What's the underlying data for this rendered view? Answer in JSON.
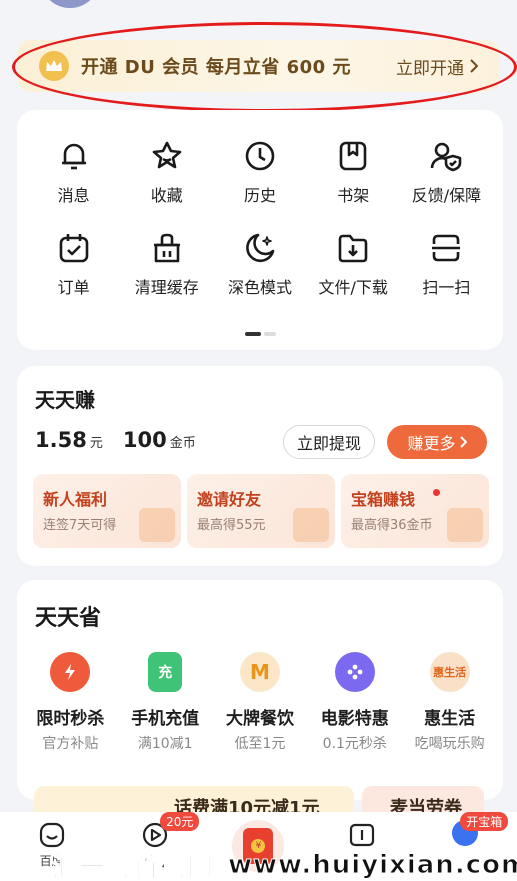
{
  "vip_banner": {
    "title": "开通 DU 会员 每月立省 600 元",
    "action": "立即开通",
    "accent": "#6b4a1c"
  },
  "tools": [
    {
      "label": "消息",
      "icon": "bell-icon"
    },
    {
      "label": "收藏",
      "icon": "star-icon"
    },
    {
      "label": "历史",
      "icon": "clock-icon"
    },
    {
      "label": "书架",
      "icon": "bookmark-icon"
    },
    {
      "label": "反馈/保障",
      "icon": "user-shield-icon"
    },
    {
      "label": "订单",
      "icon": "calendar-check-icon"
    },
    {
      "label": "清理缓存",
      "icon": "clean-cache-icon"
    },
    {
      "label": "深色模式",
      "icon": "moon-icon"
    },
    {
      "label": "文件/下载",
      "icon": "folder-download-icon"
    },
    {
      "label": "扫一扫",
      "icon": "scan-icon"
    }
  ],
  "earn": {
    "title": "天天赚",
    "cash_value": "1.58",
    "cash_unit": "元",
    "coins_value": "100",
    "coins_unit": "金币",
    "withdraw_label": "立即提现",
    "earn_more_label": "赚更多",
    "tasks": [
      {
        "title": "新人福利",
        "subtitle": "连签7天可得"
      },
      {
        "title": "邀请好友",
        "subtitle": "最高得55元"
      },
      {
        "title": "宝箱赚钱",
        "subtitle": "最高得36金币"
      }
    ],
    "accent": "#ee6a3c"
  },
  "save": {
    "title": "天天省",
    "items": [
      {
        "label": "限时秒杀",
        "subtitle": "官方补贴",
        "icon": "flash-clock-icon",
        "color": "#ef5a3b"
      },
      {
        "label": "手机充值",
        "subtitle": "满10减1",
        "icon": "phone-recharge-icon",
        "icon_text": "充",
        "color": "#3fc477"
      },
      {
        "label": "大牌餐饮",
        "subtitle": "低至1元",
        "icon": "mcdonalds-icon",
        "icon_text": "M",
        "color": "#f1a53d"
      },
      {
        "label": "电影特惠",
        "subtitle": "0.1元秒杀",
        "icon": "film-reel-icon",
        "color": "#7b6af0"
      },
      {
        "label": "惠生活",
        "subtitle": "吃喝玩乐购",
        "icon": "hui-life-icon",
        "icon_text": "惠生活",
        "color": "#f08a3c"
      }
    ]
  },
  "promo": {
    "left_text": "话费满10元减1元",
    "right_text": "麦当劳券"
  },
  "tabbar": [
    {
      "label": "百度",
      "icon": "baidu-face-icon"
    },
    {
      "label": "",
      "icon": "video-play-icon",
      "badge": "20元"
    },
    {
      "label": "",
      "icon": "red-packet-icon",
      "coin_text": "¥"
    },
    {
      "label": "",
      "icon": "book-icon"
    },
    {
      "label": "",
      "icon": "treasure-face-icon",
      "badge": "开宝箱"
    }
  ],
  "watermark": {
    "cn": "汇一线首码网",
    "url": "www.huiyixian.com"
  }
}
